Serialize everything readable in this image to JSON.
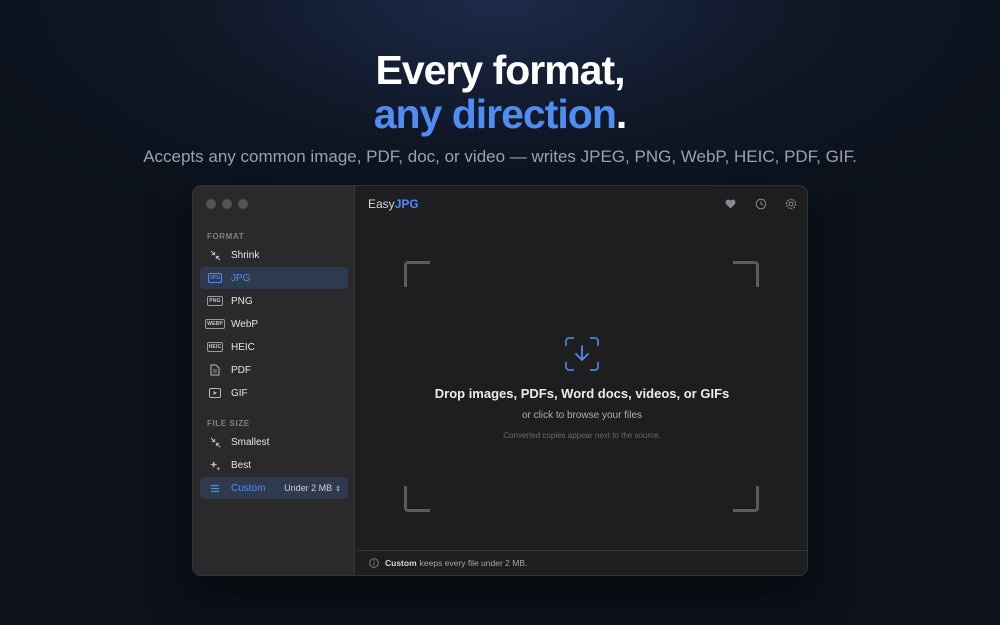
{
  "hero": {
    "title_line1": "Every format,",
    "title_accent": "any direction",
    "title_period": ".",
    "subtitle": "Accepts any common image, PDF, doc, or video — writes JPEG, PNG, WebP, HEIC, PDF, GIF."
  },
  "app": {
    "title_prefix": "Easy",
    "title_brand": "JPG"
  },
  "sidebar": {
    "format_label": "FORMAT",
    "format_items": [
      {
        "label": "Shrink",
        "icon": "shrink-icon",
        "selected": false
      },
      {
        "label": "JPG",
        "icon": "jpg-badge",
        "badge": "JPG",
        "selected": true
      },
      {
        "label": "PNG",
        "icon": "png-badge",
        "badge": "PNG",
        "selected": false
      },
      {
        "label": "WebP",
        "icon": "webp-badge",
        "badge": "WEBP",
        "selected": false
      },
      {
        "label": "HEIC",
        "icon": "heic-badge",
        "badge": "HEIC",
        "selected": false
      },
      {
        "label": "PDF",
        "icon": "document-icon",
        "selected": false
      },
      {
        "label": "GIF",
        "icon": "play-icon",
        "selected": false
      }
    ],
    "size_label": "FILE SIZE",
    "size_items": [
      {
        "label": "Smallest",
        "icon": "shrink-icon",
        "selected": false
      },
      {
        "label": "Best",
        "icon": "sparkle-icon",
        "selected": false
      },
      {
        "label": "Custom",
        "icon": "list-icon",
        "selected": true,
        "value": "Under 2 MB"
      }
    ]
  },
  "dropzone": {
    "title": "Drop images, PDFs, Word docs, videos, or GIFs",
    "subtitle": "or click to browse your files",
    "note": "Converted copies appear next to the source."
  },
  "footer": {
    "bold": "Custom",
    "text": "keeps every file under 2 MB."
  },
  "colors": {
    "accent": "#4f8df5",
    "window_bg": "#1e1e20",
    "sidebar_bg": "#2a2a2d",
    "selected_bg": "#303a4f"
  }
}
